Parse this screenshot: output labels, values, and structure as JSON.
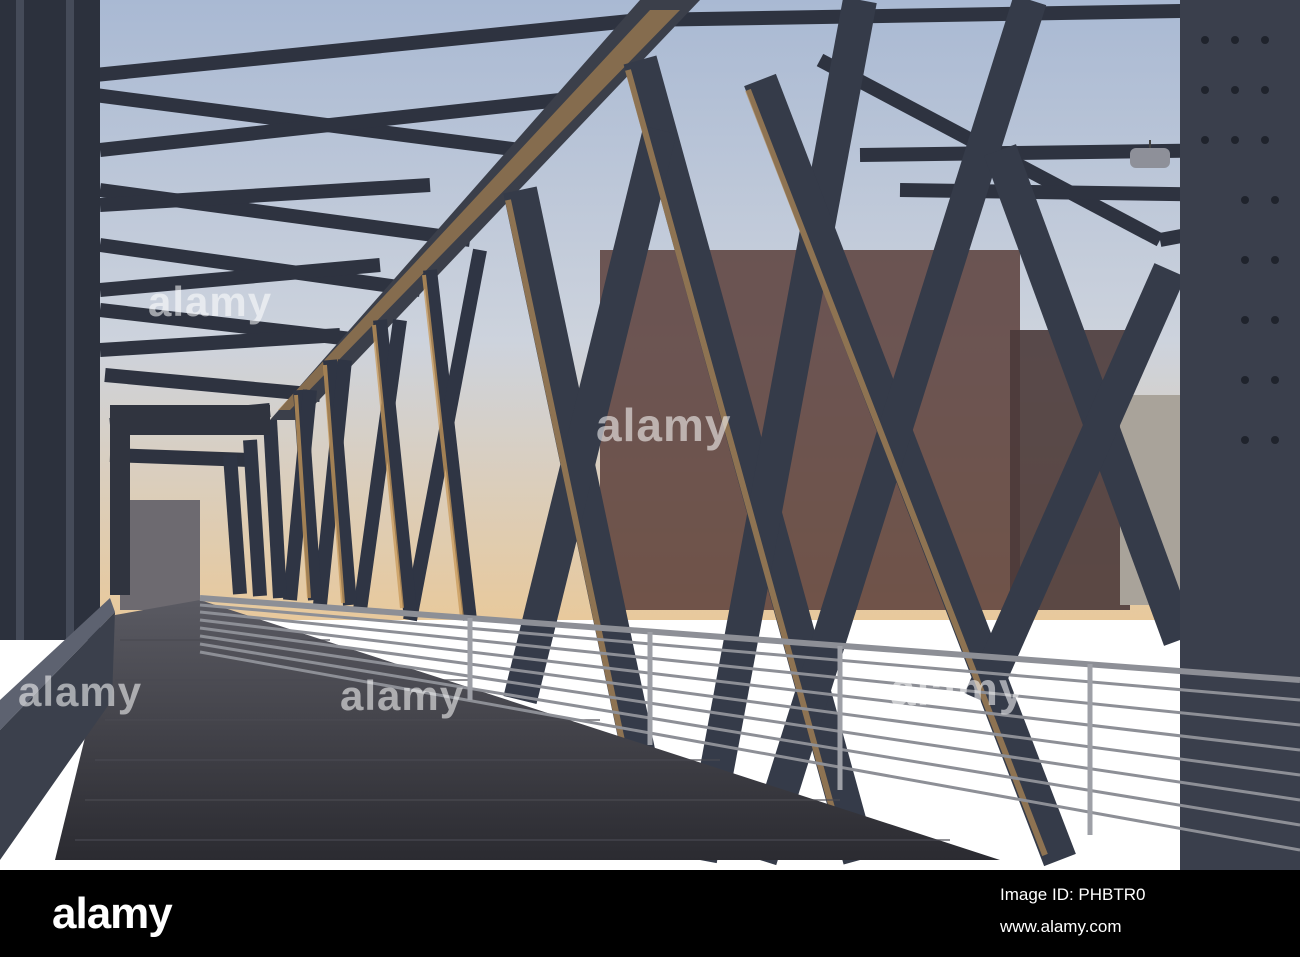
{
  "photo": {
    "subject": "steel truss footbridge at dusk",
    "sky_top": "#b3c2d9",
    "sky_bottom": "#e6c9a0",
    "steel_color": "#2f3544",
    "highlight_color": "#c99a5a",
    "deck_color": "#3a3a40"
  },
  "watermarks": [
    {
      "text": "alamy"
    },
    {
      "text": "alamy"
    },
    {
      "text": "alamy"
    },
    {
      "text": "alamy"
    },
    {
      "text": "alamy"
    }
  ],
  "footer": {
    "logo": "alamy",
    "image_id_label": "Image ID: PHBTR0",
    "site": "www.alamy.com"
  }
}
